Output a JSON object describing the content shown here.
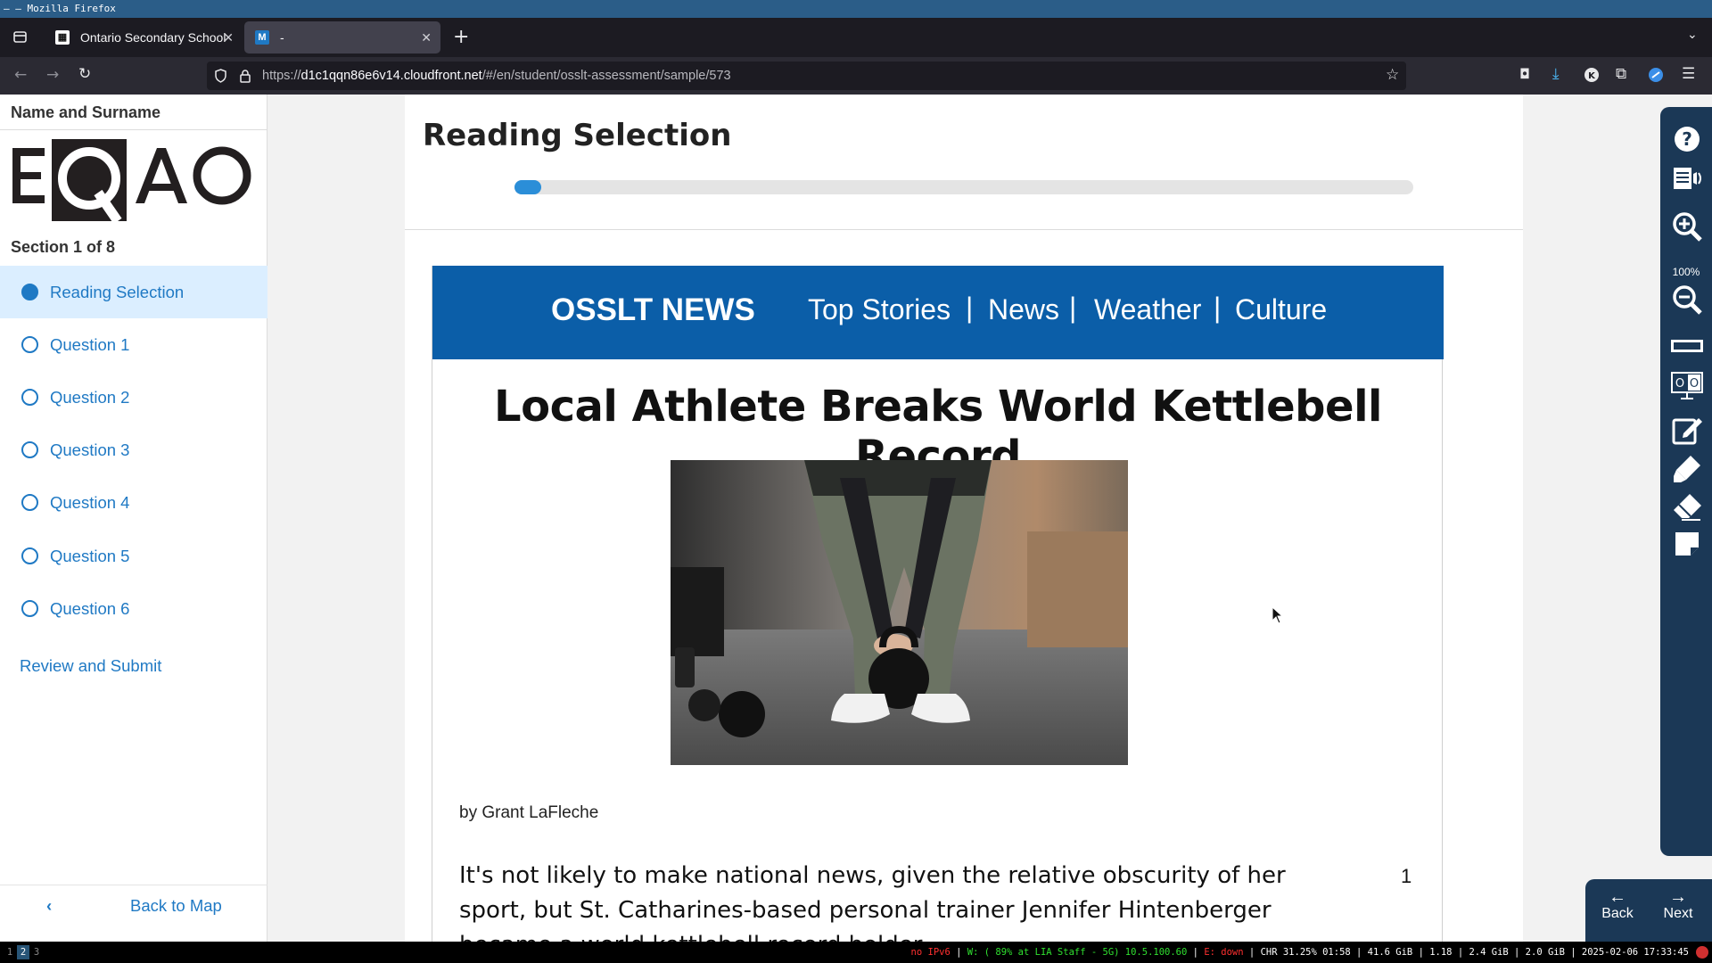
{
  "window": {
    "title": "– – Mozilla Firefox"
  },
  "tabs": [
    {
      "label": "Ontario Secondary School",
      "favicon": "eqao-favicon"
    },
    {
      "label": "-",
      "favicon": "M"
    }
  ],
  "address": {
    "prefix": "https://",
    "host": "d1c1qqn86e6v14.cloudfront.net",
    "path": "/#/en/student/osslt-assessment/sample/573"
  },
  "sidebar": {
    "student_name": "Name and Surname",
    "logo_text": "EQAO",
    "section_label": "Section 1 of 8",
    "items": [
      {
        "label": "Reading Selection",
        "active": true
      },
      {
        "label": "Question 1"
      },
      {
        "label": "Question 2"
      },
      {
        "label": "Question 3"
      },
      {
        "label": "Question 4"
      },
      {
        "label": "Question 5"
      },
      {
        "label": "Question 6"
      }
    ],
    "review_label": "Review and Submit",
    "back_to_map": "Back to Map"
  },
  "main": {
    "title": "Reading Selection",
    "progress_fraction": 0.03
  },
  "article": {
    "brand": "OSSLT NEWS",
    "nav": [
      "Top Stories",
      "News",
      "Weather",
      "Culture"
    ],
    "separator": "|",
    "headline": "Local Athlete Breaks World Kettlebell Record",
    "byline": "by Grant LaFleche",
    "paragraph_number": "1",
    "paragraph": "It's not likely to make national news, given the relative obscurity of her sport, but St. Catharines-based personal trainer Jennifer Hintenberger became a world kettlebell record holder"
  },
  "toolbar": {
    "zoom": "100%",
    "tools": [
      "help-icon",
      "text-to-speech-icon",
      "zoom-in-icon",
      "zoom-out-icon",
      "line-reader-icon",
      "hi-contrast-icon",
      "notepad-icon",
      "highlighter-icon",
      "eraser-icon",
      "sticky-note-icon"
    ]
  },
  "navigation": {
    "back": "Back",
    "next": "Next"
  },
  "statusbar": {
    "workspaces": [
      "1",
      "2",
      "3"
    ],
    "ipv6": "no IPv6",
    "wifi": "W: ( 89% at LIA Staff - 5G) 10.5.100.60",
    "ethernet": "E: down",
    "rest": "CHR 31.25% 01:58 | 41.6 GiB | 1.18 | 2.4 GiB | 2.0 GiB | 2025-02-06 17:33:45"
  },
  "colors": {
    "accent": "#1f79c4",
    "news_header": "#0b5ea8",
    "toolbar": "#1b3856",
    "active_item": "#dbeeff"
  }
}
